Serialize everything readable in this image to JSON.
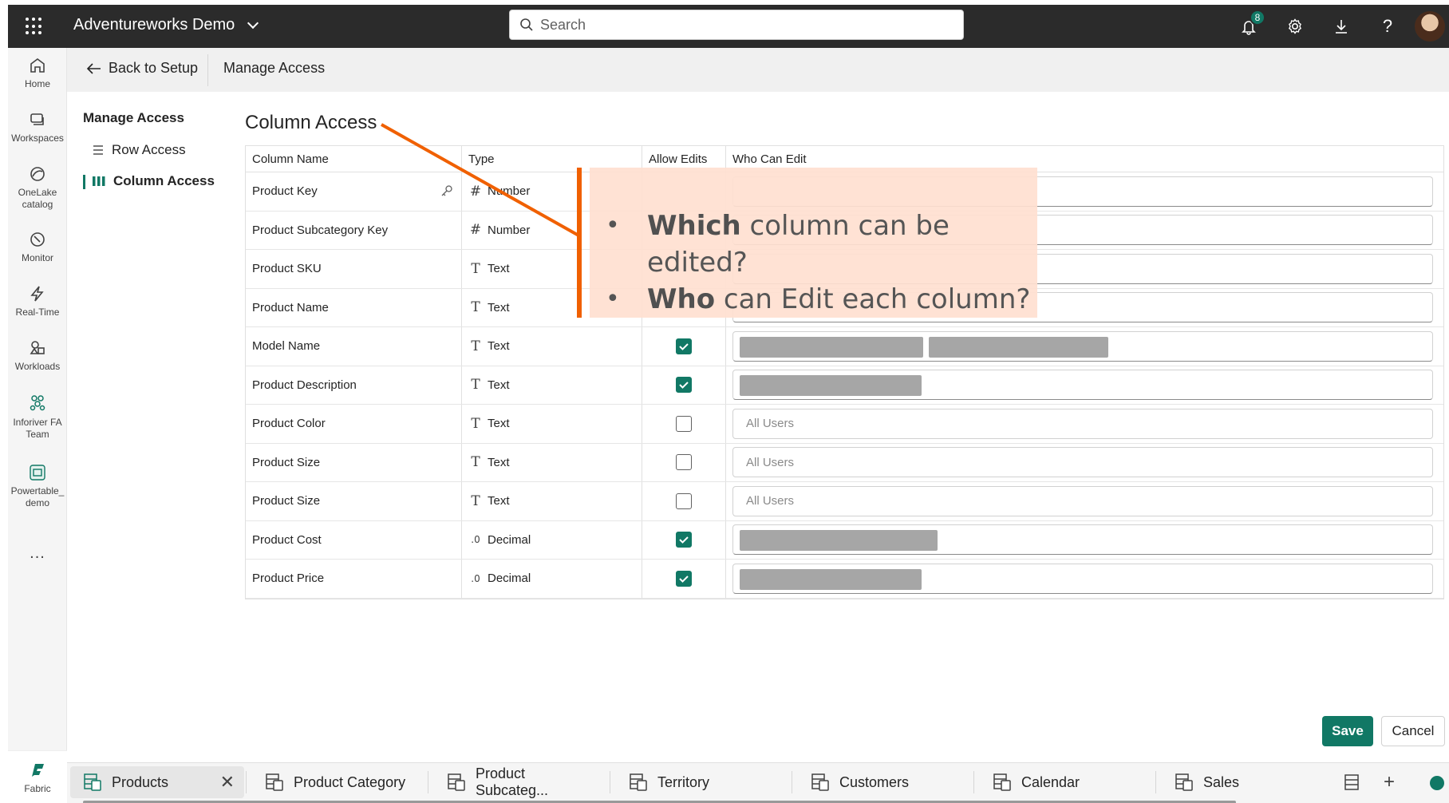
{
  "topbar": {
    "app_title": "Adventureworks Demo",
    "search_placeholder": "Search",
    "notification_count": "8"
  },
  "rail": {
    "items": [
      {
        "label": "Home",
        "icon": "home-icon"
      },
      {
        "label": "Workspaces",
        "icon": "workspaces-icon"
      },
      {
        "label": "OneLake catalog",
        "icon": "onelake-icon"
      },
      {
        "label": "Monitor",
        "icon": "monitor-icon"
      },
      {
        "label": "Real-Time",
        "icon": "lightning-icon"
      },
      {
        "label": "Workloads",
        "icon": "workloads-icon"
      },
      {
        "label": "Inforiver FA Team",
        "icon": "team-icon"
      },
      {
        "label": "Powertable_ demo",
        "icon": "powertable-icon"
      }
    ],
    "more": "...",
    "fabric_label": "Fabric"
  },
  "subheader": {
    "back_label": "Back to Setup",
    "title": "Manage Access"
  },
  "leftnav": {
    "title": "Manage Access",
    "row_access": "Row Access",
    "column_access": "Column Access"
  },
  "main": {
    "title": "Column Access",
    "headers": {
      "column_name": "Column Name",
      "type": "Type",
      "allow_edits": "Allow Edits",
      "who_can_edit": "Who Can Edit"
    },
    "rows": [
      {
        "name": "Product Key",
        "type": "Number",
        "type_icon": "#",
        "allow": null,
        "who": ""
      },
      {
        "name": "Product Subcategory Key",
        "type": "Number",
        "type_icon": "#",
        "allow": null,
        "who": ""
      },
      {
        "name": "Product SKU",
        "type": "Text",
        "type_icon": "T",
        "allow": null,
        "who": ""
      },
      {
        "name": "Product Name",
        "type": "Text",
        "type_icon": "T",
        "allow": null,
        "who": ""
      },
      {
        "name": "Model Name",
        "type": "Text",
        "type_icon": "T",
        "allow": true,
        "who": ""
      },
      {
        "name": "Product Description",
        "type": "Text",
        "type_icon": "T",
        "allow": true,
        "who": ""
      },
      {
        "name": "Product Color",
        "type": "Text",
        "type_icon": "T",
        "allow": false,
        "who": "All Users"
      },
      {
        "name": "Product Size",
        "type": "Text",
        "type_icon": "T",
        "allow": false,
        "who": "All Users"
      },
      {
        "name": "Product Size",
        "type": "Text",
        "type_icon": "T",
        "allow": false,
        "who": "All Users"
      },
      {
        "name": "Product Cost",
        "type": "Decimal",
        "type_icon": ".0",
        "allow": true,
        "who": ""
      },
      {
        "name": "Product Price",
        "type": "Decimal",
        "type_icon": ".0",
        "allow": true,
        "who": ""
      }
    ]
  },
  "callout": {
    "line1_bold": "Which",
    "line1_rest": " column can be edited?",
    "line2_bold": "Who",
    "line2_rest": " can Edit each column?"
  },
  "actions": {
    "save": "Save",
    "cancel": "Cancel"
  },
  "tabs": [
    {
      "label": "Products",
      "active": true
    },
    {
      "label": "Product Category"
    },
    {
      "label": "Product Subcateg..."
    },
    {
      "label": "Territory"
    },
    {
      "label": "Customers"
    },
    {
      "label": "Calendar"
    },
    {
      "label": "Sales"
    }
  ],
  "colors": {
    "accent": "#117865",
    "topbar": "#2b2b2b",
    "callout_bg": "#ffdfd0",
    "callout_line": "#f06000"
  }
}
